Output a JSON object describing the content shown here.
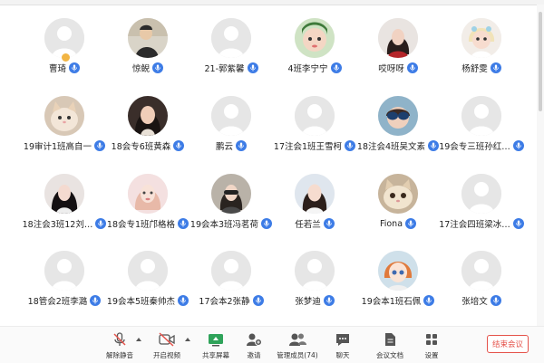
{
  "participants": [
    {
      "name": "曹琦",
      "avatar": "placeholder",
      "host": true
    },
    {
      "name": "惊鲵",
      "avatar": "photo"
    },
    {
      "name": "21-郭紫馨",
      "avatar": "placeholder"
    },
    {
      "name": "4班李宁宁",
      "avatar": "photo"
    },
    {
      "name": "哎呀呀",
      "avatar": "photo"
    },
    {
      "name": "杨舒雯",
      "avatar": "photo"
    },
    {
      "name": "19审计1班高自一",
      "avatar": "photo"
    },
    {
      "name": "18会专6班黄森",
      "avatar": "photo"
    },
    {
      "name": "鹏云",
      "avatar": "placeholder"
    },
    {
      "name": "17注会1班王雪柯",
      "avatar": "placeholder"
    },
    {
      "name": "18注会4班吴文素",
      "avatar": "photo"
    },
    {
      "name": "19会专三班孙红…",
      "avatar": "placeholder"
    },
    {
      "name": "18注会3班12刘…",
      "avatar": "photo"
    },
    {
      "name": "18会专1班邝格格",
      "avatar": "photo"
    },
    {
      "name": "19会本3班冯茗荷",
      "avatar": "photo"
    },
    {
      "name": "任若兰",
      "avatar": "photo"
    },
    {
      "name": "Fiona",
      "avatar": "photo"
    },
    {
      "name": "17注会四班梁冰…",
      "avatar": "placeholder"
    },
    {
      "name": "18管会2班李潞",
      "avatar": "placeholder"
    },
    {
      "name": "19会本5班秦帅杰",
      "avatar": "placeholder"
    },
    {
      "name": "17会本2张静",
      "avatar": "placeholder"
    },
    {
      "name": "张梦迪",
      "avatar": "placeholder"
    },
    {
      "name": "19会本1班石佩",
      "avatar": "photo"
    },
    {
      "name": "张培文",
      "avatar": "placeholder"
    }
  ],
  "toolbar": {
    "mute": "解除静音",
    "video": "开启视频",
    "share": "共享屏幕",
    "invite": "邀请",
    "members": "管理成员(74)",
    "chat": "聊天",
    "docs": "会议文档",
    "settings": "设置",
    "end": "结束会议"
  },
  "colors": {
    "mic_badge": "#3d7ce6",
    "end_button": "#e5534b",
    "share_icon": "#2fa35a",
    "host_badge": "#f2b544"
  }
}
